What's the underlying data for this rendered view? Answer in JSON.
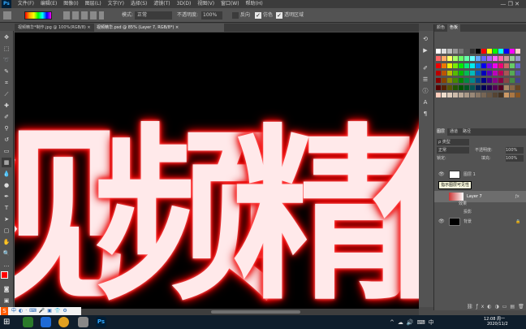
{
  "menu": [
    "文件(F)",
    "编辑(E)",
    "图像(I)",
    "图层(L)",
    "文字(Y)",
    "选择(S)",
    "滤镜(T)",
    "3D(D)",
    "视图(V)",
    "窗口(W)",
    "帮助(H)"
  ],
  "options": {
    "mode_label": "模式:",
    "mode_value": "正常",
    "opacity_label": "不透明度:",
    "opacity_value": "100%",
    "reverse_label": "反向",
    "dither_label": "仿色",
    "transparency_label": "透明区域"
  },
  "tabs": [
    "视频精华*制作.jpg @ 100%(RGB/8) ×",
    "视频精华.psd @ 85% (Layer 7, RGB/8*) ×"
  ],
  "canvas": {
    "chars": [
      "视",
      "频",
      "精",
      "住"
    ]
  },
  "panels": {
    "color_tabs": [
      "颜色",
      "色板"
    ],
    "layer_tabs": [
      "图层",
      "通道",
      "路径"
    ],
    "kind_label": "ρ 类型",
    "blend_mode": "正常",
    "opacity_label": "不透明度:",
    "opacity_value": "100%",
    "lock_label": "锁定:",
    "fill_label": "填充:",
    "fill_value": "100%",
    "layers": [
      {
        "name": "图层 1",
        "tooltip": "指示图层可见性"
      },
      {
        "name": "Layer 7"
      },
      {
        "name": "效果"
      },
      {
        "name": "投影"
      },
      {
        "name": "背景"
      }
    ]
  },
  "taskbar": {
    "time": "12:08 周一",
    "date": "2020/11/2"
  },
  "colors": {
    "accent": "#ff0000",
    "glyph_fill": "#ffe9ea"
  }
}
